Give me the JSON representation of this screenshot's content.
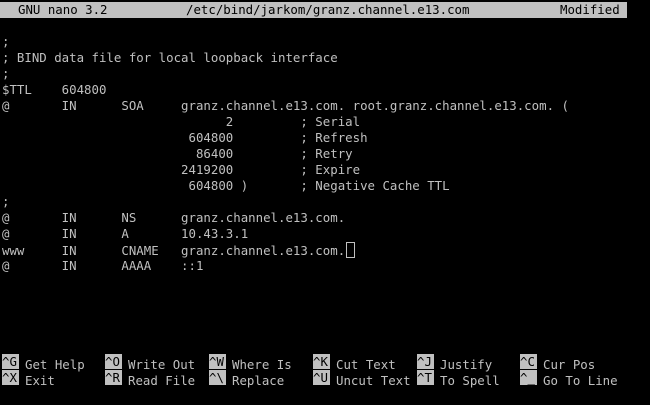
{
  "titlebar": {
    "app": "GNU nano 3.2",
    "filename": "/etc/bind/jarkom/granz.channel.e13.com",
    "status": "Modified"
  },
  "editor": {
    "lines": [
      ";",
      "; BIND data file for local loopback interface",
      ";",
      "$TTL    604800",
      "@       IN      SOA     granz.channel.e13.com. root.granz.channel.e13.com. (",
      "                              2         ; Serial",
      "                         604800         ; Refresh",
      "                          86400         ; Retry",
      "                        2419200         ; Expire",
      "                         604800 )       ; Negative Cache TTL",
      ";",
      "@       IN      NS      granz.channel.e13.com.",
      "@       IN      A       10.43.3.1",
      "www     IN      CNAME   granz.channel.e13.com.",
      "@       IN      AAAA    ::1"
    ]
  },
  "shortcuts": {
    "row1": [
      {
        "key": "^G",
        "label": "Get Help"
      },
      {
        "key": "^O",
        "label": "Write Out"
      },
      {
        "key": "^W",
        "label": "Where Is"
      },
      {
        "key": "^K",
        "label": "Cut Text"
      },
      {
        "key": "^J",
        "label": "Justify"
      },
      {
        "key": "^C",
        "label": "Cur Pos"
      }
    ],
    "row2": [
      {
        "key": "^X",
        "label": "Exit"
      },
      {
        "key": "^R",
        "label": "Read File"
      },
      {
        "key": "^\\",
        "label": "Replace"
      },
      {
        "key": "^U",
        "label": "Uncut Text"
      },
      {
        "key": "^T",
        "label": "To Spell"
      },
      {
        "key": "^_",
        "label": "Go To Line"
      }
    ]
  }
}
